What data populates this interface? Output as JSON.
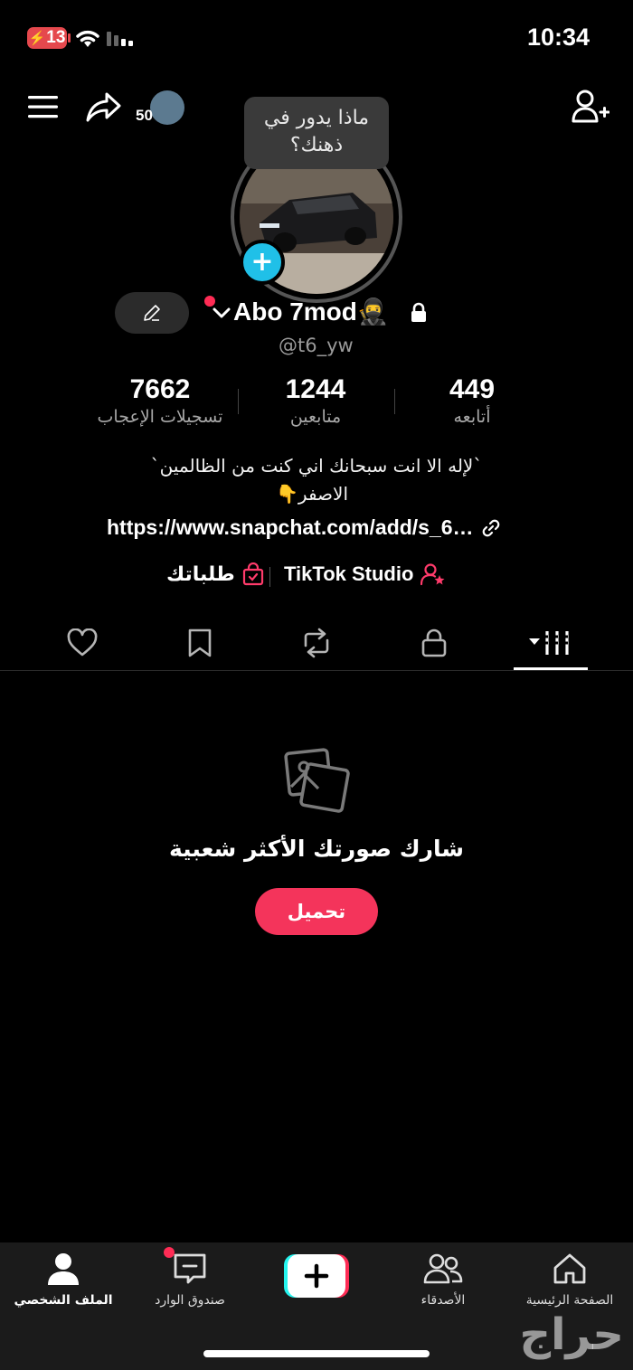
{
  "status_bar": {
    "battery": "13",
    "time": "10:34"
  },
  "header": {
    "share_count": "50",
    "thought_bubble": "ماذا يدور في ذهنك؟"
  },
  "profile": {
    "display_name": "Abo 7mod🥷",
    "handle": "@t6_yw",
    "stats": [
      {
        "value": "449",
        "label": "أتابعه"
      },
      {
        "value": "1244",
        "label": "متابعين"
      },
      {
        "value": "7662",
        "label": "تسجيلات الإعجاب"
      }
    ],
    "bio_line1": "`لإله الا انت سبحانك اني كنت من الظالمين`",
    "bio_line2": "الاصفر👇",
    "link": "https://www.snapchat.com/add/s_6…",
    "studio_label": "TikTok Studio",
    "orders_label": "طلباتك"
  },
  "empty_state": {
    "title": "شارك صورتك الأكثر شعبية",
    "button": "تحميل"
  },
  "bottom_nav": [
    {
      "label": "الصفحة الرئيسية",
      "icon": "home-icon"
    },
    {
      "label": "الأصدقاء",
      "icon": "friends-icon"
    },
    {
      "label": "",
      "icon": "create-icon"
    },
    {
      "label": "صندوق الوارد",
      "icon": "inbox-icon"
    },
    {
      "label": "الملف الشخصي",
      "icon": "profile-icon"
    }
  ],
  "watermark": "حراج",
  "colors": {
    "accent": "#f4345b",
    "avatar_add": "#20c0e8",
    "background": "#000000"
  }
}
